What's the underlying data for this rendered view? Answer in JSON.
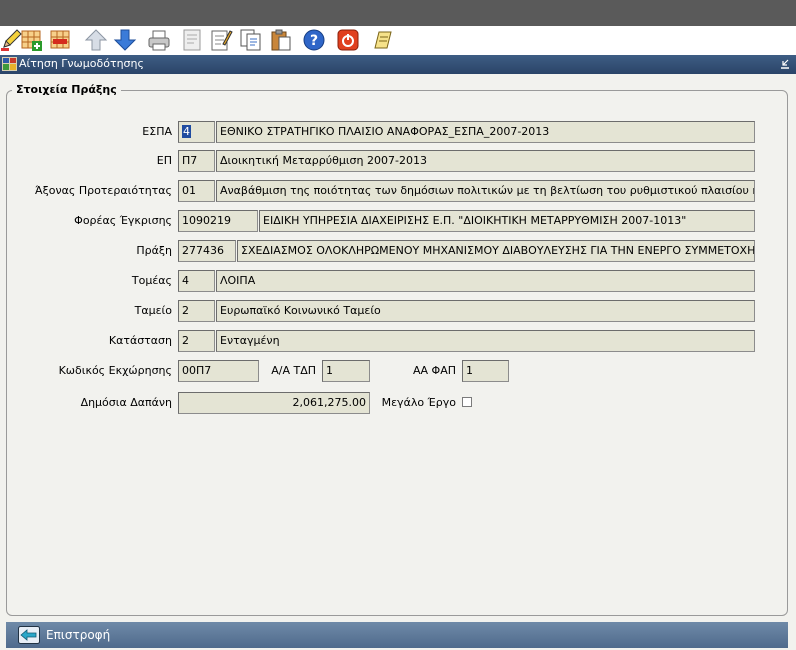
{
  "window": {
    "title": "Αίτηση Γνωμοδότησης"
  },
  "toolbar": {
    "buttons": [
      {
        "name": "edit-pencil"
      },
      {
        "name": "insert-record"
      },
      {
        "name": "delete-record"
      },
      {
        "name": "move-up"
      },
      {
        "name": "move-down"
      },
      {
        "name": "print"
      },
      {
        "name": "print-preview"
      },
      {
        "name": "edit-notes"
      },
      {
        "name": "copy"
      },
      {
        "name": "paste"
      },
      {
        "name": "help"
      },
      {
        "name": "exit"
      },
      {
        "name": "report"
      }
    ]
  },
  "section": {
    "legend": "Στοιχεία Πράξης"
  },
  "form": {
    "espa": {
      "label": "ΕΣΠΑ",
      "code": "4",
      "value": "ΕΘΝΙΚΟ ΣΤΡΑΤΗΓΙΚΟ ΠΛΑΙΣΙΟ ΑΝΑΦΟΡΑΣ_ΕΣΠΑ_2007-2013"
    },
    "ep": {
      "label": "ΕΠ",
      "code": "Π7",
      "value": "Διοικητική Μεταρρύθμιση 2007-2013"
    },
    "axonas": {
      "label": "Άξονας Προτεραιότητας",
      "code": "01",
      "value": "Αναβάθμιση της ποιότητας των δημόσιων πολιτικών με τη βελτίωση του ρυθμιστικού πλαισίου και του"
    },
    "foreas": {
      "label": "Φορέας Έγκρισης",
      "code": "1090219",
      "value": "ΕΙΔΙΚΗ ΥΠΗΡΕΣΙΑ ΔΙΑΧΕΙΡΙΣΗΣ Ε.Π. \"ΔΙΟΙΚΗΤΙΚΗ ΜΕΤΑΡΡΥΘΜΙΣΗ 2007-1013\""
    },
    "praxi": {
      "label": "Πράξη",
      "code": "277436",
      "value": "ΣΧΕΔΙΑΣΜΟΣ ΟΛΟΚΛΗΡΩΜΕΝΟΥ ΜΗΧΑΝΙΣΜΟΥ ΔΙΑΒΟΥΛΕΥΣΗΣ ΓΙΑ ΤΗΝ ΕΝΕΡΓΟ ΣΥΜΜΕΤΟΧΗ"
    },
    "tomeas": {
      "label": "Τομέας",
      "code": "4",
      "value": "ΛΟΙΠΑ"
    },
    "tameio": {
      "label": "Ταμείο",
      "code": "2",
      "value": "Ευρωπαϊκό Κοινωνικό Ταμείο"
    },
    "katastasi": {
      "label": "Κατάσταση",
      "code": "2",
      "value": "Ενταγμένη"
    },
    "kodikos": {
      "label": "Κωδικός Εκχώρησης",
      "value": "00Π7"
    },
    "aa_tdp": {
      "label": "Α/Α ΤΔΠ",
      "value": "1"
    },
    "aa_fap": {
      "label": "ΑΑ ΦΑΠ",
      "value": "1"
    },
    "dapani": {
      "label": "Δημόσια Δαπάνη",
      "value": "2,061,275.00"
    },
    "megalo": {
      "label": "Μεγάλο Έργο",
      "checked": false
    }
  },
  "footer": {
    "back_label": "Επιστροφή"
  },
  "colors": {
    "field_bg": "#e4e4d4",
    "frame_bg": "#f2f2ee",
    "titlebar": "#2f4c72",
    "bottombar": "#5f7a9a"
  }
}
